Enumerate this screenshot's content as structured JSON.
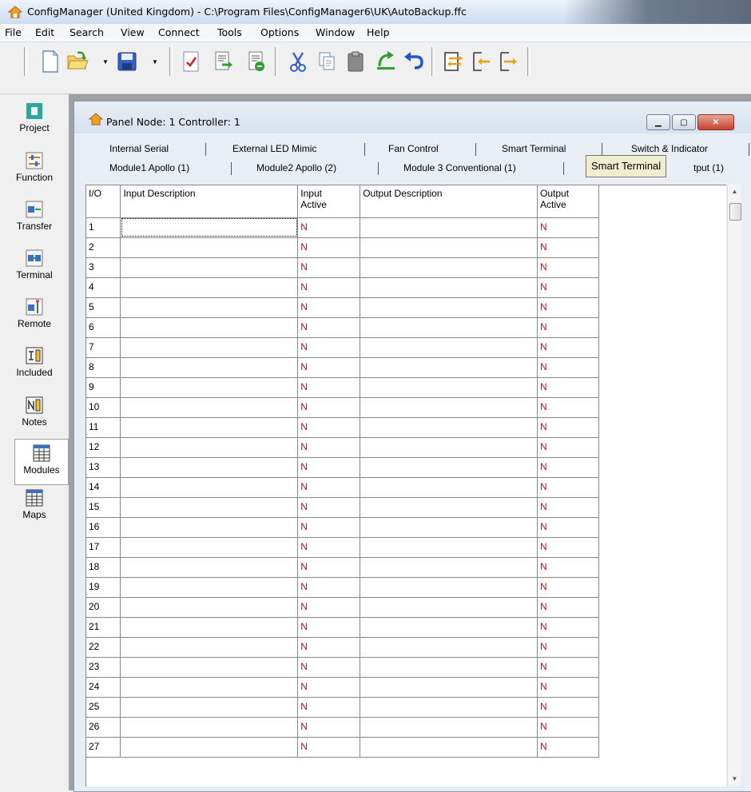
{
  "window": {
    "title": "ConfigManager (United Kingdom) - C:\\Program Files\\ConfigManager6\\UK\\AutoBackup.ffc",
    "app_icon": "house-icon"
  },
  "menu": [
    "File",
    "Edit",
    "Search",
    "View",
    "Connect",
    "Tools",
    "Options",
    "Window",
    "Help"
  ],
  "toolbar": {
    "icons": [
      "new-document-icon",
      "open-folder-icon",
      "save-icon",
      "check-document-icon",
      "export-icon",
      "import-icon",
      "cut-icon",
      "copy-icon",
      "paste-icon",
      "upload-icon",
      "undo-icon",
      "panel-arrows-icon",
      "panel-left-icon",
      "panel-right-icon"
    ]
  },
  "sidebar": {
    "items": [
      {
        "label": "Project",
        "icon": "project-icon"
      },
      {
        "label": "Function",
        "icon": "function-icon"
      },
      {
        "label": "Transfer",
        "icon": "transfer-icon"
      },
      {
        "label": "Terminal",
        "icon": "terminal-icon"
      },
      {
        "label": "Remote",
        "icon": "remote-icon"
      },
      {
        "label": "Included",
        "icon": "included-icon"
      },
      {
        "label": "Notes",
        "icon": "notes-icon"
      },
      {
        "label": "Modules",
        "icon": "modules-icon",
        "selected": true
      },
      {
        "label": "Maps",
        "icon": "maps-icon"
      }
    ]
  },
  "child_window": {
    "title": "Panel Node: 1 Controller: 1",
    "tabs_row1": [
      "Internal Serial",
      "External LED Mimic",
      "Fan Control",
      "Smart Terminal",
      "Switch & Indicator"
    ],
    "tabs_row2": [
      "Module1 Apollo (1)",
      "Module2 Apollo (2)",
      "Module 3 Conventional (1)",
      "tput (1)"
    ],
    "tooltip": "Smart Terminal"
  },
  "grid": {
    "headers": [
      "I/O",
      "Input Description",
      "Input\nActive",
      "Output Description",
      "Output\nActive"
    ],
    "rows": [
      {
        "io": "1",
        "in_desc": "",
        "in_active": "N",
        "out_desc": "",
        "out_active": "N"
      },
      {
        "io": "2",
        "in_desc": "",
        "in_active": "N",
        "out_desc": "",
        "out_active": "N"
      },
      {
        "io": "3",
        "in_desc": "",
        "in_active": "N",
        "out_desc": "",
        "out_active": "N"
      },
      {
        "io": "4",
        "in_desc": "",
        "in_active": "N",
        "out_desc": "",
        "out_active": "N"
      },
      {
        "io": "5",
        "in_desc": "",
        "in_active": "N",
        "out_desc": "",
        "out_active": "N"
      },
      {
        "io": "6",
        "in_desc": "",
        "in_active": "N",
        "out_desc": "",
        "out_active": "N"
      },
      {
        "io": "7",
        "in_desc": "",
        "in_active": "N",
        "out_desc": "",
        "out_active": "N"
      },
      {
        "io": "8",
        "in_desc": "",
        "in_active": "N",
        "out_desc": "",
        "out_active": "N"
      },
      {
        "io": "9",
        "in_desc": "",
        "in_active": "N",
        "out_desc": "",
        "out_active": "N"
      },
      {
        "io": "10",
        "in_desc": "",
        "in_active": "N",
        "out_desc": "",
        "out_active": "N"
      },
      {
        "io": "11",
        "in_desc": "",
        "in_active": "N",
        "out_desc": "",
        "out_active": "N"
      },
      {
        "io": "12",
        "in_desc": "",
        "in_active": "N",
        "out_desc": "",
        "out_active": "N"
      },
      {
        "io": "13",
        "in_desc": "",
        "in_active": "N",
        "out_desc": "",
        "out_active": "N"
      },
      {
        "io": "14",
        "in_desc": "",
        "in_active": "N",
        "out_desc": "",
        "out_active": "N"
      },
      {
        "io": "15",
        "in_desc": "",
        "in_active": "N",
        "out_desc": "",
        "out_active": "N"
      },
      {
        "io": "16",
        "in_desc": "",
        "in_active": "N",
        "out_desc": "",
        "out_active": "N"
      },
      {
        "io": "17",
        "in_desc": "",
        "in_active": "N",
        "out_desc": "",
        "out_active": "N"
      },
      {
        "io": "18",
        "in_desc": "",
        "in_active": "N",
        "out_desc": "",
        "out_active": "N"
      },
      {
        "io": "19",
        "in_desc": "",
        "in_active": "N",
        "out_desc": "",
        "out_active": "N"
      },
      {
        "io": "20",
        "in_desc": "",
        "in_active": "N",
        "out_desc": "",
        "out_active": "N"
      },
      {
        "io": "21",
        "in_desc": "",
        "in_active": "N",
        "out_desc": "",
        "out_active": "N"
      },
      {
        "io": "22",
        "in_desc": "",
        "in_active": "N",
        "out_desc": "",
        "out_active": "N"
      },
      {
        "io": "23",
        "in_desc": "",
        "in_active": "N",
        "out_desc": "",
        "out_active": "N"
      },
      {
        "io": "24",
        "in_desc": "",
        "in_active": "N",
        "out_desc": "",
        "out_active": "N"
      },
      {
        "io": "25",
        "in_desc": "",
        "in_active": "N",
        "out_desc": "",
        "out_active": "N"
      },
      {
        "io": "26",
        "in_desc": "",
        "in_active": "N",
        "out_desc": "",
        "out_active": "N"
      },
      {
        "io": "27",
        "in_desc": "",
        "in_active": "N",
        "out_desc": "",
        "out_active": "N"
      }
    ]
  },
  "colors": {
    "inactive_red": "#e00000",
    "title_blue": "#dbe6f4"
  }
}
